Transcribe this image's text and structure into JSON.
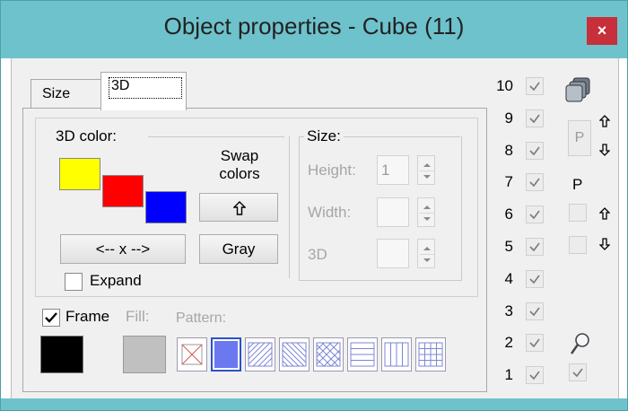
{
  "window": {
    "title": "Object properties - Cube (11)",
    "close_glyph": "×",
    "titlebar_color": "#6ec2cc",
    "close_color": "#c7303a"
  },
  "tabs": [
    {
      "label": "Size",
      "active": false
    },
    {
      "label": "3D",
      "active": true
    }
  ],
  "color3d": {
    "group_label": "3D color:",
    "swatches": [
      {
        "name": "front",
        "color": "#ffff00"
      },
      {
        "name": "side",
        "color": "#ff0000"
      },
      {
        "name": "top",
        "color": "#0000ff"
      }
    ],
    "swap_label_1": "Swap",
    "swap_label_2": "colors",
    "swap_icon": "arrow-up-icon",
    "x_button": "<-- x -->",
    "gray_button": "Gray",
    "expand_label": "Expand",
    "expand_checked": false
  },
  "size_group": {
    "label": "Size:",
    "height_label": "Height:",
    "height_value": "1",
    "width_label": "Width:",
    "width_value": "",
    "depth_label": "3D",
    "depth_value": ""
  },
  "frame": {
    "label": "Frame",
    "checked": true,
    "color": "#000000",
    "fill_label": "Fill:",
    "fill_color": "#c0c0c0",
    "pattern_label": "Pattern:",
    "patterns": [
      "none-icon",
      "solid-icon",
      "diag-right-icon",
      "diag-left-icon",
      "crosshatch-diag-icon",
      "horizontal-lines-icon",
      "vertical-lines-icon",
      "grid-icon"
    ],
    "selected_pattern": 1,
    "pattern_color": "#6b78f0"
  },
  "layers": {
    "items": [
      {
        "num": "10",
        "checked": true
      },
      {
        "num": "9",
        "checked": true
      },
      {
        "num": "8",
        "checked": true
      },
      {
        "num": "7",
        "checked": true
      },
      {
        "num": "6",
        "checked": true
      },
      {
        "num": "5",
        "checked": true
      },
      {
        "num": "4",
        "checked": true
      },
      {
        "num": "3",
        "checked": true
      },
      {
        "num": "2",
        "checked": true
      },
      {
        "num": "1",
        "checked": true
      }
    ],
    "stack_icon": "layers-stack-icon",
    "p_box": "P",
    "p_label": "P",
    "magnifier_icon": "magnifier-icon",
    "bottom_checked": true
  }
}
